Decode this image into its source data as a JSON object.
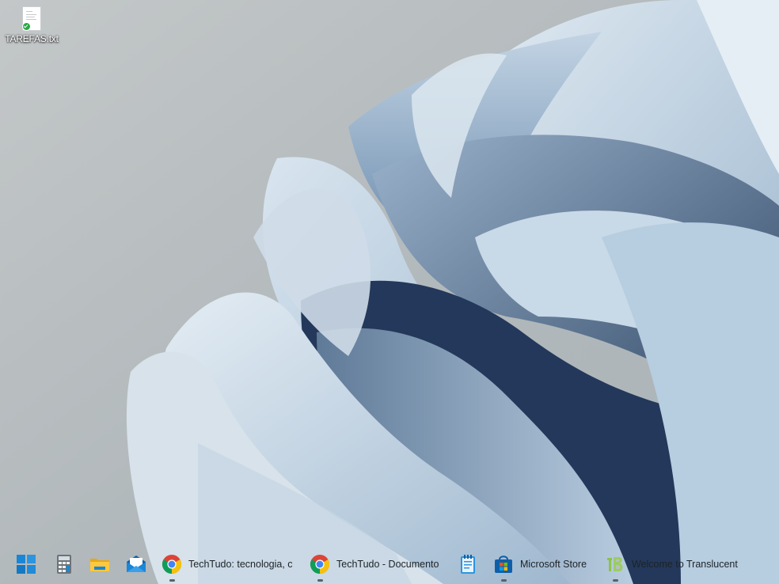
{
  "desktop": {
    "icons": [
      {
        "label": "TAREFAS.txt",
        "icon": "text-file-icon",
        "badge": "sync-check-icon"
      }
    ]
  },
  "taskbar": {
    "items": [
      {
        "id": "start",
        "icon": "windows-start-icon",
        "label": ""
      },
      {
        "id": "calculator",
        "icon": "calculator-icon",
        "label": ""
      },
      {
        "id": "file-explorer",
        "icon": "folder-icon",
        "label": ""
      },
      {
        "id": "mail",
        "icon": "mail-icon",
        "label": ""
      },
      {
        "id": "chrome-1",
        "icon": "chrome-icon",
        "label": "TechTudo: tecnologia, c"
      },
      {
        "id": "chrome-2",
        "icon": "chrome-icon",
        "label": "TechTudo - Documento"
      },
      {
        "id": "notepad",
        "icon": "notepad-icon",
        "label": ""
      },
      {
        "id": "store",
        "icon": "microsoft-store-icon",
        "label": "Microsoft Store"
      },
      {
        "id": "translucenttb",
        "icon": "translucenttb-icon",
        "label": "Welcome to Translucent"
      }
    ]
  },
  "colors": {
    "accent": "#1a86d6",
    "chrome_red": "#db4437",
    "chrome_yellow": "#f4c20d",
    "chrome_green": "#0f9d58",
    "chrome_blue": "#4285f4"
  }
}
